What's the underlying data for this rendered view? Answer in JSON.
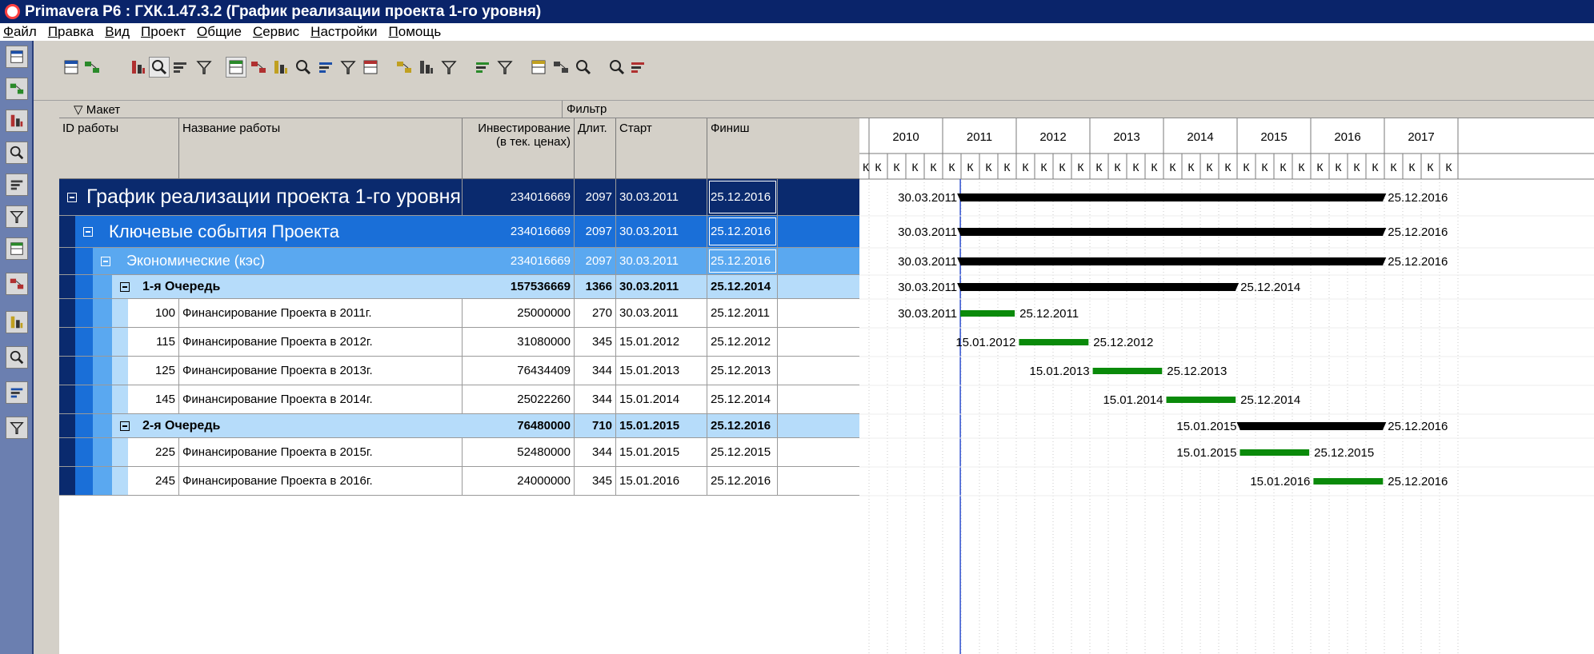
{
  "window": {
    "title": "Primavera P6 : ГХК.1.47.3.2 (График реализации проекта 1-го уровня)"
  },
  "menu": [
    "Файл",
    "Правка",
    "Вид",
    "Проект",
    "Общие",
    "Сервис",
    "Настройки",
    "Помощь"
  ],
  "layout_bar": {
    "layout": "▽ Макет",
    "filter": "Фильтр"
  },
  "columns": {
    "id": "ID работы",
    "name": "Название работы",
    "invest_line1": "Инвестирование",
    "invest_line2": "(в тек. ценах)",
    "duration": "Длит.",
    "start": "Старт",
    "finish": "Финиш"
  },
  "timescale": {
    "years": [
      "2010",
      "2011",
      "2012",
      "2013",
      "2014",
      "2015",
      "2016",
      "2017"
    ],
    "quarter_label": "К"
  },
  "rows": [
    {
      "kind": "wbs1",
      "id": "",
      "name": "График реализации проекта 1-го уровня",
      "invest": "234016669",
      "duration": "2097",
      "start": "30.03.2011",
      "finish": "25.12.2016",
      "bar_start": "30.03.2011",
      "bar_finish": "25.12.2016",
      "bar_type": "summary"
    },
    {
      "kind": "wbs2",
      "id": "",
      "name": "Ключевые события Проекта",
      "invest": "234016669",
      "duration": "2097",
      "start": "30.03.2011",
      "finish": "25.12.2016",
      "bar_start": "30.03.2011",
      "bar_finish": "25.12.2016",
      "bar_type": "summary"
    },
    {
      "kind": "wbs3",
      "id": "",
      "name": "Экономические (кэс)",
      "invest": "234016669",
      "duration": "2097",
      "start": "30.03.2011",
      "finish": "25.12.2016",
      "bar_start": "30.03.2011",
      "bar_finish": "25.12.2016",
      "bar_type": "summary"
    },
    {
      "kind": "wbs4",
      "id": "",
      "name": "1-я Очередь",
      "invest": "157536669",
      "duration": "1366",
      "start": "30.03.2011",
      "finish": "25.12.2014",
      "bar_start": "30.03.2011",
      "bar_finish": "25.12.2014",
      "bar_type": "summary"
    },
    {
      "kind": "task",
      "id": "100",
      "name": "Финансирование Проекта в 2011г.",
      "invest": "25000000",
      "duration": "270",
      "start": "30.03.2011",
      "finish": "25.12.2011",
      "bar_start": "30.03.2011",
      "bar_finish": "25.12.2011",
      "bar_type": "task"
    },
    {
      "kind": "task",
      "id": "115",
      "name": "Финансирование Проекта в 2012г.",
      "invest": "31080000",
      "duration": "345",
      "start": "15.01.2012",
      "finish": "25.12.2012",
      "bar_start": "15.01.2012",
      "bar_finish": "25.12.2012",
      "bar_type": "task"
    },
    {
      "kind": "task",
      "id": "125",
      "name": "Финансирование Проекта в 2013г.",
      "invest": "76434409",
      "duration": "344",
      "start": "15.01.2013",
      "finish": "25.12.2013",
      "bar_start": "15.01.2013",
      "bar_finish": "25.12.2013",
      "bar_type": "task"
    },
    {
      "kind": "task",
      "id": "145",
      "name": "Финансирование Проекта в 2014г.",
      "invest": "25022260",
      "duration": "344",
      "start": "15.01.2014",
      "finish": "25.12.2014",
      "bar_start": "15.01.2014",
      "bar_finish": "25.12.2014",
      "bar_type": "task"
    },
    {
      "kind": "wbs4",
      "id": "",
      "name": "2-я Очередь",
      "invest": "76480000",
      "duration": "710",
      "start": "15.01.2015",
      "finish": "25.12.2016",
      "bar_start": "15.01.2015",
      "bar_finish": "25.12.2016",
      "bar_type": "summary"
    },
    {
      "kind": "task",
      "id": "225",
      "name": "Финансирование Проекта в 2015г.",
      "invest": "52480000",
      "duration": "344",
      "start": "15.01.2015",
      "finish": "25.12.2015",
      "bar_start": "15.01.2015",
      "bar_finish": "25.12.2015",
      "bar_type": "task"
    },
    {
      "kind": "task",
      "id": "245",
      "name": "Финансирование Проекта в 2016г.",
      "invest": "24000000",
      "duration": "345",
      "start": "15.01.2016",
      "finish": "25.12.2016",
      "bar_start": "15.01.2016",
      "bar_finish": "25.12.2016",
      "bar_type": "task"
    }
  ],
  "colors": {
    "title_bg": "#0a246a",
    "wbs1_bg": "#0a2a6e",
    "wbs2_bg": "#1a6fd8",
    "wbs3_bg": "#5aa8f0",
    "wbs4_bg": "#b6dcfa",
    "summary_bar": "#000000",
    "task_bar": "#0a8a0a",
    "data_date_line": "#3050d0"
  },
  "icons": {
    "sidebar": [
      "projects-icon",
      "resources-icon",
      "reports-icon",
      "tracking-icon",
      "wbs-icon",
      "activities-icon",
      "assignments-icon",
      "work-products-icon",
      "expenses-icon",
      "issues-icon",
      "risks-icon",
      "exit-icon"
    ],
    "toolbar": [
      "print-icon",
      "print-preview-icon",
      "layout-table-icon",
      "layout-gantt-icon",
      "relationship-icon",
      "network-icon",
      "activity-table-icon",
      "gantt-chart-icon",
      "activity-profile-icon",
      "resource-usage-icon",
      "resource-profile-icon",
      "activity-network-icon",
      "trace-logic-icon",
      "columns-icon",
      "bars-icon",
      "filter-icon",
      "group-icon",
      "schedule-icon",
      "level-icon",
      "progress-icon",
      "zoom-in-icon",
      "zoom-out-icon",
      "collapse-icon"
    ]
  }
}
